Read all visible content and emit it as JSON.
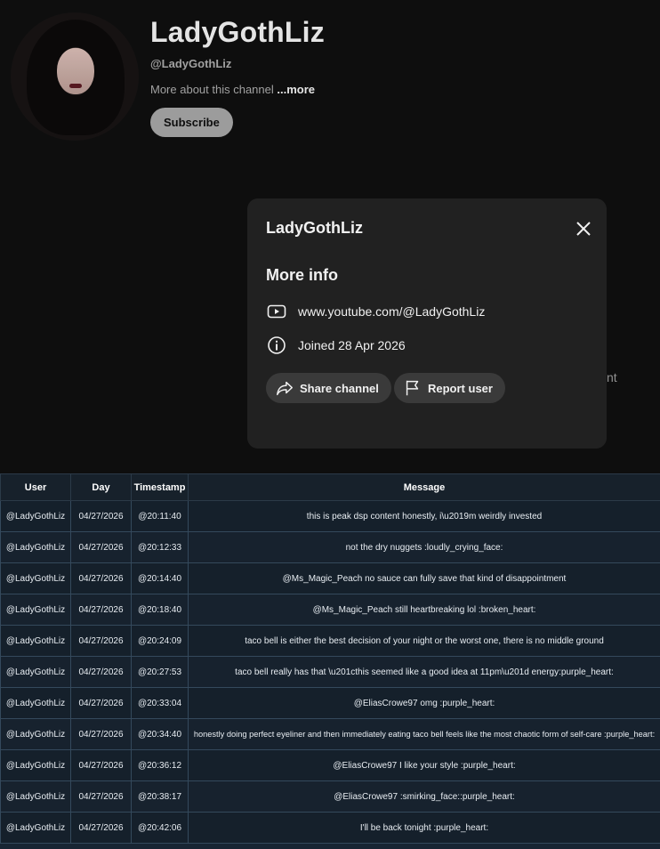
{
  "channel": {
    "name": "LadyGothLiz",
    "handle": "@LadyGothLiz",
    "more_about": "More about this channel",
    "more_link": "...more",
    "subscribe_label": "Subscribe",
    "behind_text": "nt"
  },
  "dialog": {
    "title": "LadyGothLiz",
    "section_title": "More info",
    "url": "www.youtube.com/@LadyGothLiz",
    "joined": "Joined 28 Apr 2026",
    "share_label": "Share channel",
    "report_label": "Report user",
    "icons": [
      "youtube-icon",
      "info-icon",
      "share-icon",
      "flag-icon",
      "close-icon"
    ]
  },
  "table": {
    "headers": [
      "User",
      "Day",
      "Timestamp",
      "Message"
    ],
    "rows": [
      [
        "@LadyGothLiz",
        "04/27/2026",
        "@20:11:40",
        "this is peak dsp content honestly, i\\u2019m weirdly invested"
      ],
      [
        "@LadyGothLiz",
        "04/27/2026",
        "@20:12:33",
        "not the dry nuggets :loudly_crying_face:"
      ],
      [
        "@LadyGothLiz",
        "04/27/2026",
        "@20:14:40",
        "@Ms_Magic_Peach no sauce can fully save that kind of disappointment"
      ],
      [
        "@LadyGothLiz",
        "04/27/2026",
        "@20:18:40",
        "@Ms_Magic_Peach still heartbreaking lol :broken_heart:"
      ],
      [
        "@LadyGothLiz",
        "04/27/2026",
        "@20:24:09",
        "taco bell is either the best decision of your night or the worst one, there is no middle ground"
      ],
      [
        "@LadyGothLiz",
        "04/27/2026",
        "@20:27:53",
        "taco bell really has that \\u201cthis seemed like a good idea at 11pm\\u201d energy:purple_heart:"
      ],
      [
        "@LadyGothLiz",
        "04/27/2026",
        "@20:33:04",
        "@EliasCrowe97 omg :purple_heart:"
      ],
      [
        "@LadyGothLiz",
        "04/27/2026",
        "@20:34:40",
        "honestly doing perfect eyeliner and then immediately eating taco bell feels like the most chaotic form of self-care :purple_heart:"
      ],
      [
        "@LadyGothLiz",
        "04/27/2026",
        "@20:36:12",
        "@EliasCrowe97 I like your style :purple_heart:"
      ],
      [
        "@LadyGothLiz",
        "04/27/2026",
        "@20:38:17",
        "@EliasCrowe97 :smirking_face::purple_heart:"
      ],
      [
        "@LadyGothLiz",
        "04/27/2026",
        "@20:42:06",
        "I'll be back tonight :purple_heart:"
      ]
    ]
  }
}
